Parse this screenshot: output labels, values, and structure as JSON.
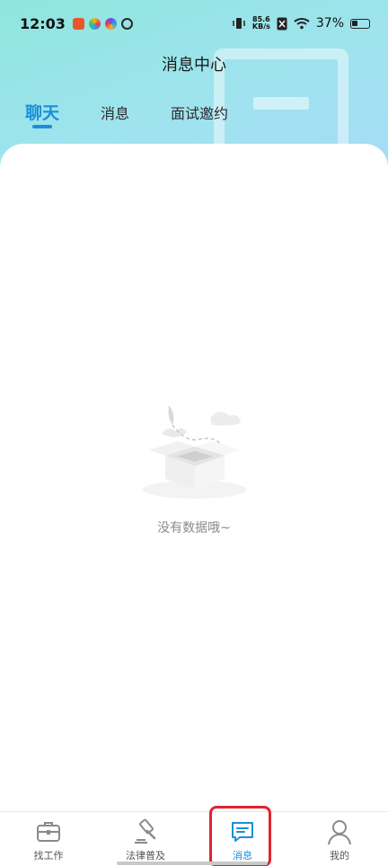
{
  "status_bar": {
    "time": "12:03",
    "net_speed_value": "85.6",
    "net_speed_unit": "KB/s",
    "battery": "37%",
    "app_icons": [
      "#e8572a",
      "#f2b21c",
      "#6a4de6",
      "#2a2a2a"
    ]
  },
  "header": {
    "title": "消息中心",
    "tabs": [
      {
        "label": "聊天",
        "active": true
      },
      {
        "label": "消息",
        "active": false
      },
      {
        "label": "面试邀约",
        "active": false
      }
    ]
  },
  "empty_state": {
    "message": "没有数据哦~"
  },
  "bottom_nav": {
    "items": [
      {
        "label": "找工作",
        "icon": "briefcase-icon"
      },
      {
        "label": "法律普及",
        "icon": "gavel-icon"
      },
      {
        "label": "消息",
        "icon": "chat-icon",
        "active": true
      },
      {
        "label": "我的",
        "icon": "user-icon"
      }
    ]
  },
  "colors": {
    "accent": "#1a8fd8",
    "highlight": "#e0242f"
  }
}
